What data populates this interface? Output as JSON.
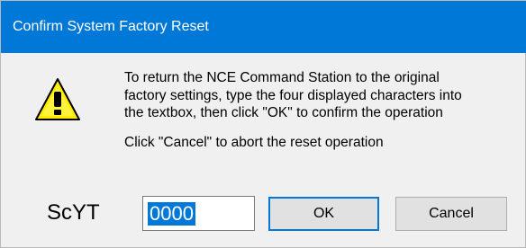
{
  "window": {
    "title": "Confirm System Factory Reset",
    "titlebar_color": "#0078d7",
    "icon": "warning-icon"
  },
  "message": {
    "lines": [
      "To return the NCE Command Station to the original",
      "factory settings, type the four displayed characters into",
      "the textbox, then click \"OK\" to confirm the operation"
    ],
    "cancel_hint": "Click \"Cancel\" to abort the reset operation"
  },
  "confirmation": {
    "code": "ScYT",
    "input_value": "0000"
  },
  "buttons": {
    "ok_label": "OK",
    "cancel_label": "Cancel"
  }
}
